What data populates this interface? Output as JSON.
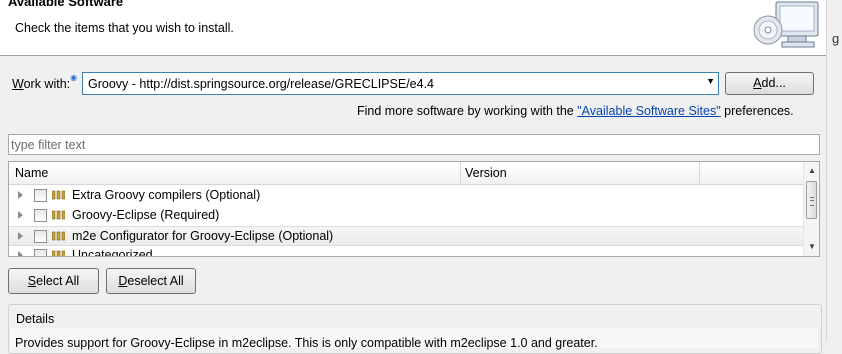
{
  "header": {
    "title": "Available Software",
    "description": "Check the items that you wish to install."
  },
  "work_with": {
    "label_prefix": "W",
    "label_rest": "ork with:",
    "value": "Groovy - http://dist.springsource.org/release/GRECLIPSE/e4.4",
    "add_label_prefix": "A",
    "add_label_rest": "dd..."
  },
  "sites": {
    "before": "Find more software by working with the ",
    "link": "\"Available Software Sites\"",
    "after": " preferences."
  },
  "filter": {
    "placeholder": "type filter text"
  },
  "table": {
    "columns": [
      "Name",
      "Version"
    ],
    "rows": [
      {
        "label": "Extra Groovy compilers (Optional)",
        "checked": false,
        "selected": false
      },
      {
        "label": "Groovy-Eclipse (Required)",
        "checked": false,
        "selected": false
      },
      {
        "label": "m2e Configurator for Groovy-Eclipse (Optional)",
        "checked": false,
        "selected": true
      },
      {
        "label": "Uncategorized",
        "checked": false,
        "selected": false
      }
    ]
  },
  "buttons": {
    "select_all_prefix": "S",
    "select_all_rest": "elect All",
    "deselect_all_prefix": "D",
    "deselect_all_rest": "eselect All"
  },
  "details": {
    "label": "Details",
    "text": "Provides support for Groovy-Eclipse in m2eclipse. This is only compatible with m2eclipse 1.0 and greater."
  },
  "icons": {
    "header": "install-cd-icon",
    "package": "package-icon",
    "info": "info-icon"
  },
  "colors": {
    "link": "#0645ad",
    "combo_border": "#3c7fb1"
  }
}
